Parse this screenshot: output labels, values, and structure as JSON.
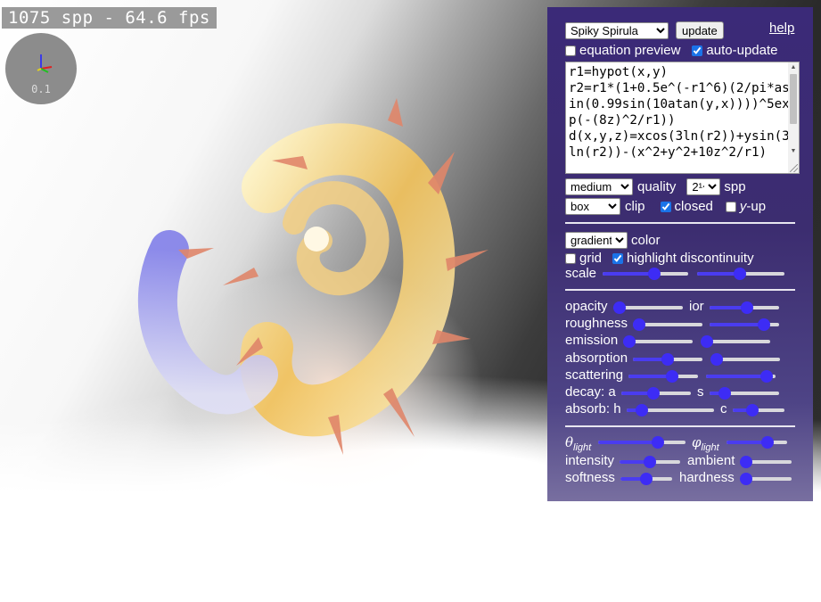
{
  "status": {
    "fps_text": "1075 spp - 64.6 fps"
  },
  "gizmo": {
    "scale_label": "0.1",
    "icon": "axes-gizmo-icon"
  },
  "panel": {
    "preset": {
      "selected": "Spiky Spirula"
    },
    "update_label": "update",
    "help_label": "help",
    "equation_preview": {
      "label": "equation preview",
      "checked": false
    },
    "auto_update": {
      "label": "auto-update",
      "checked": true
    },
    "equation_text": "r1=hypot(x,y)\nr2=r1*(1+0.5e^(-r1^6)(2/pi*asin(0.99sin(10atan(y,x))))^5exp(-(8z)^2/r1))\nd(x,y,z)=xcos(3ln(r2))+ysin(3ln(r2))-(x^2+y^2+10z^2/r1)",
    "quality": {
      "selected": "medium",
      "label": "quality"
    },
    "spp": {
      "selected": "2¹⁴",
      "label": "spp"
    },
    "clip": {
      "selected": "box",
      "label": "clip"
    },
    "closed": {
      "label": "closed",
      "checked": true
    },
    "y_up": {
      "label_var": "y",
      "label_rest": "-up",
      "checked": false
    },
    "color": {
      "selected": "gradient",
      "label": "color"
    },
    "grid": {
      "label": "grid",
      "checked": false
    },
    "highlight_discontinuity": {
      "label": "highlight discontinuity",
      "checked": true
    },
    "scale_label": "scale",
    "material_labels": {
      "opacity": "opacity",
      "ior": "ior",
      "roughness": "roughness",
      "emission": "emission",
      "absorption": "absorption",
      "scattering": "scattering",
      "decay": "decay: a",
      "decay_s": "s",
      "absorb": "absorb: h",
      "absorb_c": "c"
    },
    "light_labels": {
      "theta": "θ",
      "theta_sub": "light",
      "phi": "φ",
      "phi_sub": "light",
      "intensity": "intensity",
      "ambient": "ambient",
      "softness": "softness",
      "hardness": "hardness"
    },
    "slider_values": {
      "scale_1": 0.62,
      "scale_2": 0.49,
      "opacity": 0.0,
      "ior": 0.55,
      "roughness": 0.0,
      "roughness_2": 0.85,
      "emission": 0.0,
      "emission_2": 0.0,
      "absorption": 0.5,
      "absorption_2": 0.0,
      "scattering": 0.65,
      "scattering_2": 0.95,
      "decay_a": 0.45,
      "decay_s": 0.15,
      "absorb_h": 0.12,
      "absorb_c": 0.35,
      "theta_light": 0.72,
      "phi_light": 0.72,
      "intensity": 0.5,
      "ambient": 0.0,
      "softness": 0.5,
      "hardness": 0.0
    }
  },
  "colors": {
    "panel": "#3b2a78",
    "slider_accent": "#3d2cf5",
    "fps_bg": "#9a9a9a"
  }
}
